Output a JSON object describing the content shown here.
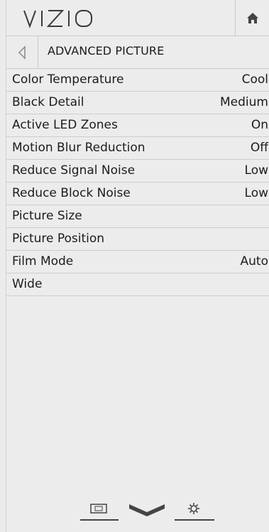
{
  "header": {
    "brand": "VIZIO",
    "home_icon": "home-icon"
  },
  "subheader": {
    "back_icon": "back-arrow-icon",
    "title": "ADVANCED PICTURE"
  },
  "menu": {
    "items": [
      {
        "label": "Color Temperature",
        "value": "Cool"
      },
      {
        "label": "Black Detail",
        "value": "Medium"
      },
      {
        "label": "Active LED Zones",
        "value": "On"
      },
      {
        "label": "Motion Blur Reduction",
        "value": "Off"
      },
      {
        "label": "Reduce Signal Noise",
        "value": "Low"
      },
      {
        "label": "Reduce Block Noise",
        "value": "Low"
      },
      {
        "label": "Picture Size",
        "value": ""
      },
      {
        "label": "Picture Position",
        "value": ""
      },
      {
        "label": "Film Mode",
        "value": "Auto"
      },
      {
        "label": "Wide",
        "value": ""
      }
    ]
  },
  "bottom_nav": {
    "icons": [
      "input-icon",
      "chevron-down-icon",
      "settings-gear-icon"
    ]
  },
  "colors": {
    "background": "#ececec",
    "text": "#1c1c1c",
    "divider": "#cdcdcd",
    "icon": "#333333"
  }
}
